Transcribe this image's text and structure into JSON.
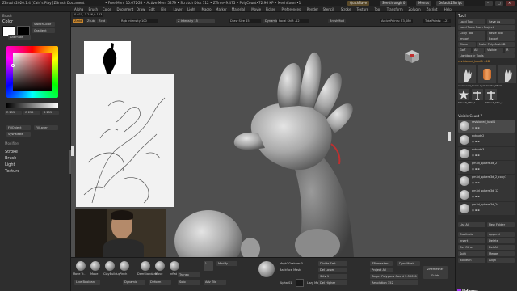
{
  "titlebar": {
    "title": "ZBrush 2020.1.4 [Cain's Play]   ZBrush Document",
    "stats": "• Free Mem 10.672GB • Active Mem 5279 • Scratch Disk 112 • ZTime•9.475 • PolyCount•72.96 KP • MeshCount•1",
    "quicksave": "QuickSave",
    "seethrough": "See-through 0",
    "menus": "Menus",
    "defaultscript": "DefaultZScript"
  },
  "menubar": {
    "items": [
      "Alpha",
      "Brush",
      "Color",
      "Document",
      "Draw",
      "Edit",
      "File",
      "Layer",
      "Light",
      "Macro",
      "Marker",
      "Material",
      "Movie",
      "Picker",
      "Preferences",
      "Render",
      "Stencil",
      "Stroke",
      "Texture",
      "Tool",
      "Transform",
      "Zplugin",
      "Zscript",
      "Help"
    ]
  },
  "infobar": {
    "coords": "0.615,-1.246,0.163",
    "zadd": "Zadd",
    "zsub": "Zsub",
    "zcut": "Zcut",
    "rgb_intensity": "Rgb Intensity 100",
    "z_intensity": "Z Intensity 15",
    "draw_size": "Draw Size 45",
    "dynamic": "Dynamic",
    "focal_shift": "Focal Shift -12",
    "brush_mod": "BrushMod",
    "active_points": "ActivePoints: 73,080",
    "total_points": "TotalPoints: 1.21"
  },
  "leftpanel": {
    "palette_title": "Color",
    "switch_color": "SwitchColor",
    "gradient": "Gradient",
    "alternate": "Alternate",
    "rgb_values": [
      "R 255",
      "G 255",
      "B 255"
    ],
    "fill_object": "FillObject",
    "sections": [
      "Modifiers",
      "Stroke",
      "Brush",
      "Light",
      "Texture"
    ]
  },
  "rightpanel": {
    "header": "Tool",
    "buttons": [
      "Load Tool",
      "Save As",
      "Load Tools From Project",
      "Copy Tool",
      "Paste Tool",
      "Import",
      "Export",
      "Clone",
      "Make PolyMesh3D",
      "GoZ",
      "All",
      "Visible",
      "R",
      "Lightbox > Tools"
    ],
    "current_tool": "revisioned_basil1 . 48",
    "tool_thumbs": [
      "revisioned_basil1",
      "Cylinder PolyMesh",
      "SimpleBrush",
      "TPoseP_SB1_1",
      "TPoseP_SB1_2"
    ],
    "subtool_header": "Visible Count 7",
    "subtools": [
      "revisioned_basil1",
      "extrude2",
      "extrude3",
      "pm3d_sphere3d_2",
      "pm3d_sphere3d_2_copy1",
      "pm3d_sphere3d_12",
      "pm3d_sphere3d_24"
    ],
    "list_all": "List All",
    "new_folder": "New Folder",
    "bottom_buttons": [
      "Duplicate",
      "Append",
      "Insert",
      "Delete",
      "Del Other",
      "Del All",
      "Split",
      "Merge",
      "Boolean",
      "Align"
    ]
  },
  "bottombar": {
    "brushes": [
      "Move Tr..",
      "Move",
      "ClayBuildup",
      "Pinch",
      "DamStandard",
      "Move",
      "Inflat"
    ],
    "buttons": [
      "Live Boolean",
      "Dynamic",
      "Deform",
      "Modify",
      "Transp",
      "Solo",
      "Adv Tile",
      "ZRemesher",
      "DynaMesh",
      "Project All",
      "Target Polygons Count 2.50051",
      "Resolution 352"
    ],
    "left_labels": [
      "Backface Mask",
      "Alpha 01",
      "Lazy Mouse"
    ],
    "mrgb_label": "MrgbZGrabber 0",
    "mid_labels": [
      "Divide Smt",
      "Del Lower",
      "Sdiv 1",
      "Del Higher"
    ],
    "polish_label": "ZRemesher Guide"
  },
  "colors": {
    "viewport_bg": "#4f4f4f",
    "panel_bg": "#2e2e2e",
    "accent": "#e8a13c",
    "active_orange": "#c8862e"
  }
}
